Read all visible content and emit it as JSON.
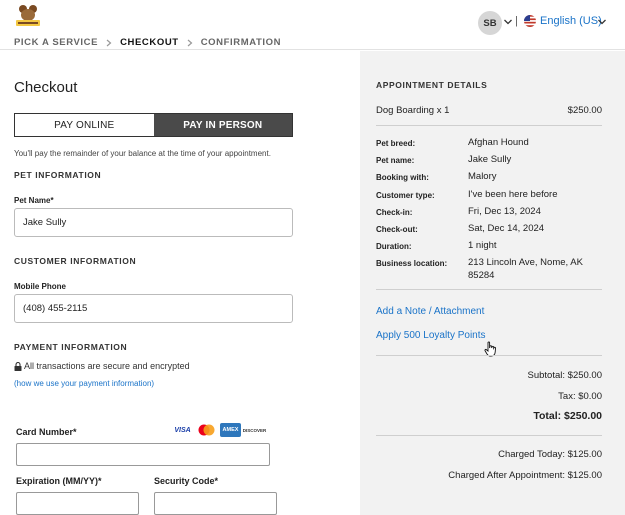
{
  "header": {
    "avatar_initials": "SB",
    "language": "English (US)",
    "separator": "|",
    "breadcrumb": [
      "PICK A SERVICE",
      "CHECKOUT",
      "CONFIRMATION"
    ]
  },
  "checkout": {
    "title": "Checkout",
    "pay_options": [
      "PAY ONLINE",
      "PAY IN PERSON"
    ],
    "selected_pay_option": "PAY IN PERSON",
    "note": "You'll pay the remainder of your balance at the time of your appointment.",
    "pet_section": "PET INFORMATION",
    "pet_name_label": "Pet Name*",
    "pet_name_value": "Jake Sully",
    "customer_section": "CUSTOMER INFORMATION",
    "phone_label": "Mobile Phone",
    "phone_value": "(408) 455-2115",
    "payment_section": "PAYMENT INFORMATION",
    "secure_text": "All transactions are secure and encrypted",
    "payment_link": "(how we use your payment information)",
    "card_number_label": "Card Number*",
    "expiration_label": "Expiration (MM/YY)*",
    "security_code_label": "Security Code*",
    "card_brands": [
      "VISA",
      "mastercard",
      "AMEX",
      "DISCOVER"
    ]
  },
  "appointment": {
    "heading": "APPOINTMENT DETAILS",
    "item": "Dog Boarding x 1",
    "item_price": "$250.00",
    "details": [
      {
        "label": "Pet breed:",
        "value": "Afghan Hound"
      },
      {
        "label": "Pet name:",
        "value": "Jake Sully"
      },
      {
        "label": "Booking with:",
        "value": "Malory"
      },
      {
        "label": "Customer type:",
        "value": "I've been here before"
      },
      {
        "label": "Check-in:",
        "value": "Fri, Dec 13, 2024"
      },
      {
        "label": "Check-out:",
        "value": "Sat, Dec 14, 2024"
      },
      {
        "label": "Duration:",
        "value": "1 night"
      },
      {
        "label": "Business location:",
        "value": "213 Lincoln Ave, Nome, AK 85284"
      }
    ],
    "add_note_link": "Add a Note / Attachment",
    "loyalty_link": "Apply 500 Loyalty Points",
    "subtotal": "Subtotal: $250.00",
    "tax": "Tax: $0.00",
    "total": "Total: $250.00",
    "charged_today": "Charged Today:  $125.00",
    "charged_after": "Charged After Appointment:  $125.00"
  },
  "colors": {
    "accent_link": "#1a73c8",
    "toggle_selected": "#4a4a4a",
    "panel_bg": "#f2f2f2"
  },
  "icons": [
    "logo-icon",
    "chevron-down-icon",
    "us-flag-icon",
    "chevron-right-icon",
    "lock-icon",
    "visa-icon",
    "mastercard-icon",
    "amex-icon",
    "discover-icon",
    "hand-cursor-icon"
  ]
}
